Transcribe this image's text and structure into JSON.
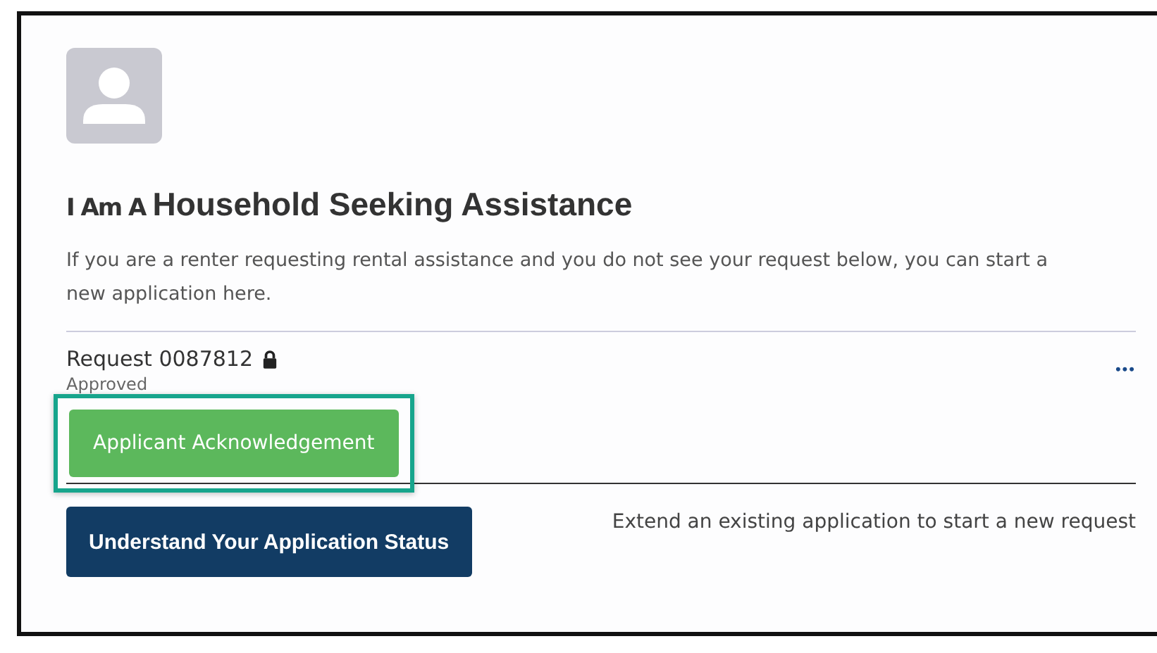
{
  "heading": {
    "prefix": "I Am A",
    "title": "Household Seeking Assistance"
  },
  "intro": "If you are a renter requesting rental assistance and you do not see your request below, you can start a new application here.",
  "request": {
    "title": "Request 0087812",
    "locked": true,
    "status": "Approved",
    "more": "•••"
  },
  "action_button": {
    "label": "Applicant Acknowledgement",
    "highlighted": true
  },
  "status_button": {
    "label": "Understand Your Application Status"
  },
  "extend_text": "Extend an existing application to start a new request"
}
